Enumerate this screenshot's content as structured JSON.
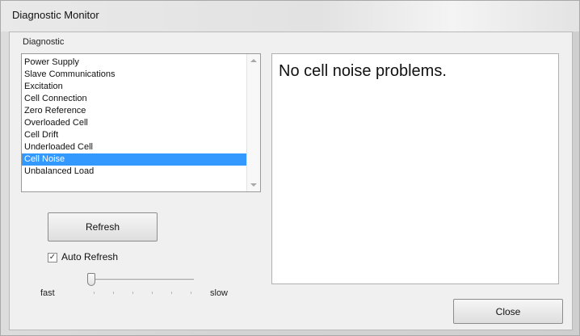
{
  "window": {
    "title": "Diagnostic Monitor"
  },
  "diagnostic": {
    "group_label": "Diagnostic",
    "items": [
      "Power Supply",
      "Slave Communications",
      "Excitation",
      "Cell Connection",
      "Zero Reference",
      "Overloaded Cell",
      "Cell Drift",
      "Underloaded Cell",
      "Cell Noise",
      "Unbalanced Load"
    ],
    "selected": "Cell Noise"
  },
  "result": {
    "message": "No cell noise problems."
  },
  "controls": {
    "refresh_label": "Refresh",
    "auto_refresh_label": "Auto Refresh",
    "auto_refresh_checked": true,
    "slider_left_label": "fast",
    "slider_right_label": "slow",
    "slider_value_fraction": 0,
    "close_label": "Close"
  },
  "colors": {
    "selection": "#3399ff"
  }
}
